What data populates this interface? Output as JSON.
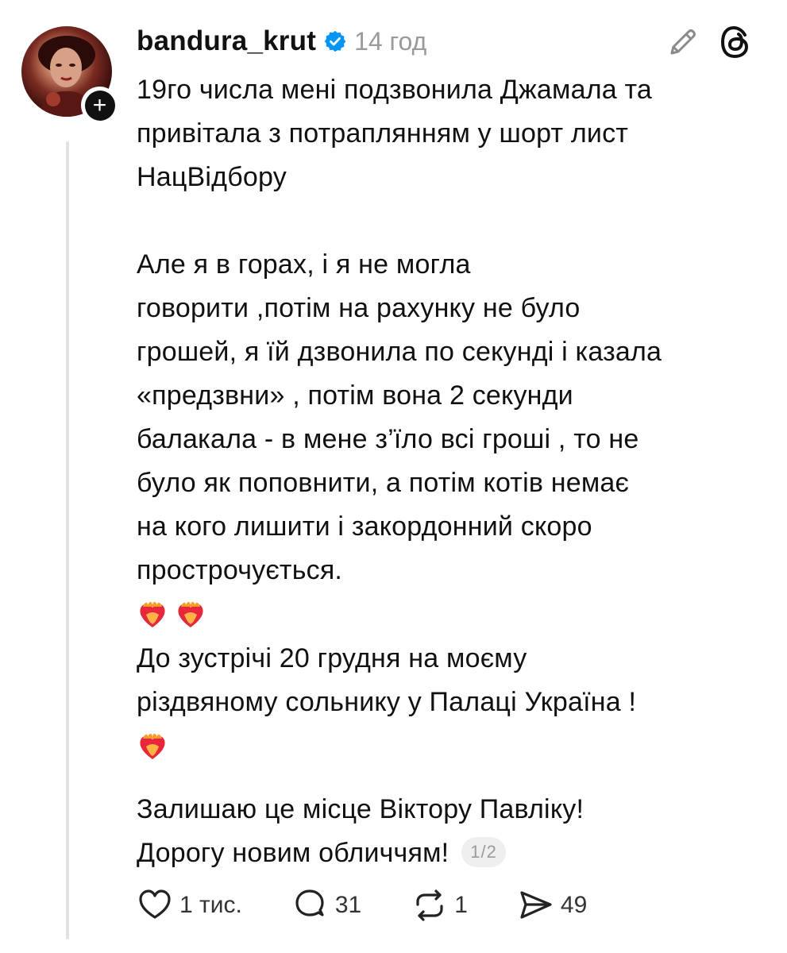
{
  "post": {
    "username": "bandura_krut",
    "timestamp": "14 год",
    "paragraphs": [
      "19го числа мені подзвонила Джамала та\nпривітала з потраплянням у шорт лист\nНацВідбору",
      "Але я в горах, і я не могла\nговорити ,потім на рахунку не було\nгрошей, я їй дзвонила по секунді і казала\n«предзвни» , потім вона 2 секунди\nбалакала - в мене з’їло всі гроші , то не\nбуло як поповнити, а потім котів немає\nна кого лишити і закордонний скоро\nпрострочується.",
      "До зустрічі 20 грудня на моєму\nріздвяному сольнику у Палаці Україна !",
      "Залишаю це місце Віктору Павліку!",
      "Дорогу новим обличчям!"
    ],
    "page_counter": "1/2"
  },
  "actions": {
    "likes": "1 тис.",
    "replies": "31",
    "reposts": "1",
    "shares": "49"
  },
  "icons": {
    "verified": "verified-badge-icon",
    "edit": "pencil-icon",
    "threads": "threads-logo-icon",
    "like": "heart-icon",
    "reply": "comment-icon",
    "repost": "repost-icon",
    "share": "send-icon",
    "emoji": "heart-on-fire-emoji"
  },
  "colors": {
    "verified": "#0095f6",
    "muted": "#9a9a9a",
    "thread_line": "#e2e2e2"
  }
}
